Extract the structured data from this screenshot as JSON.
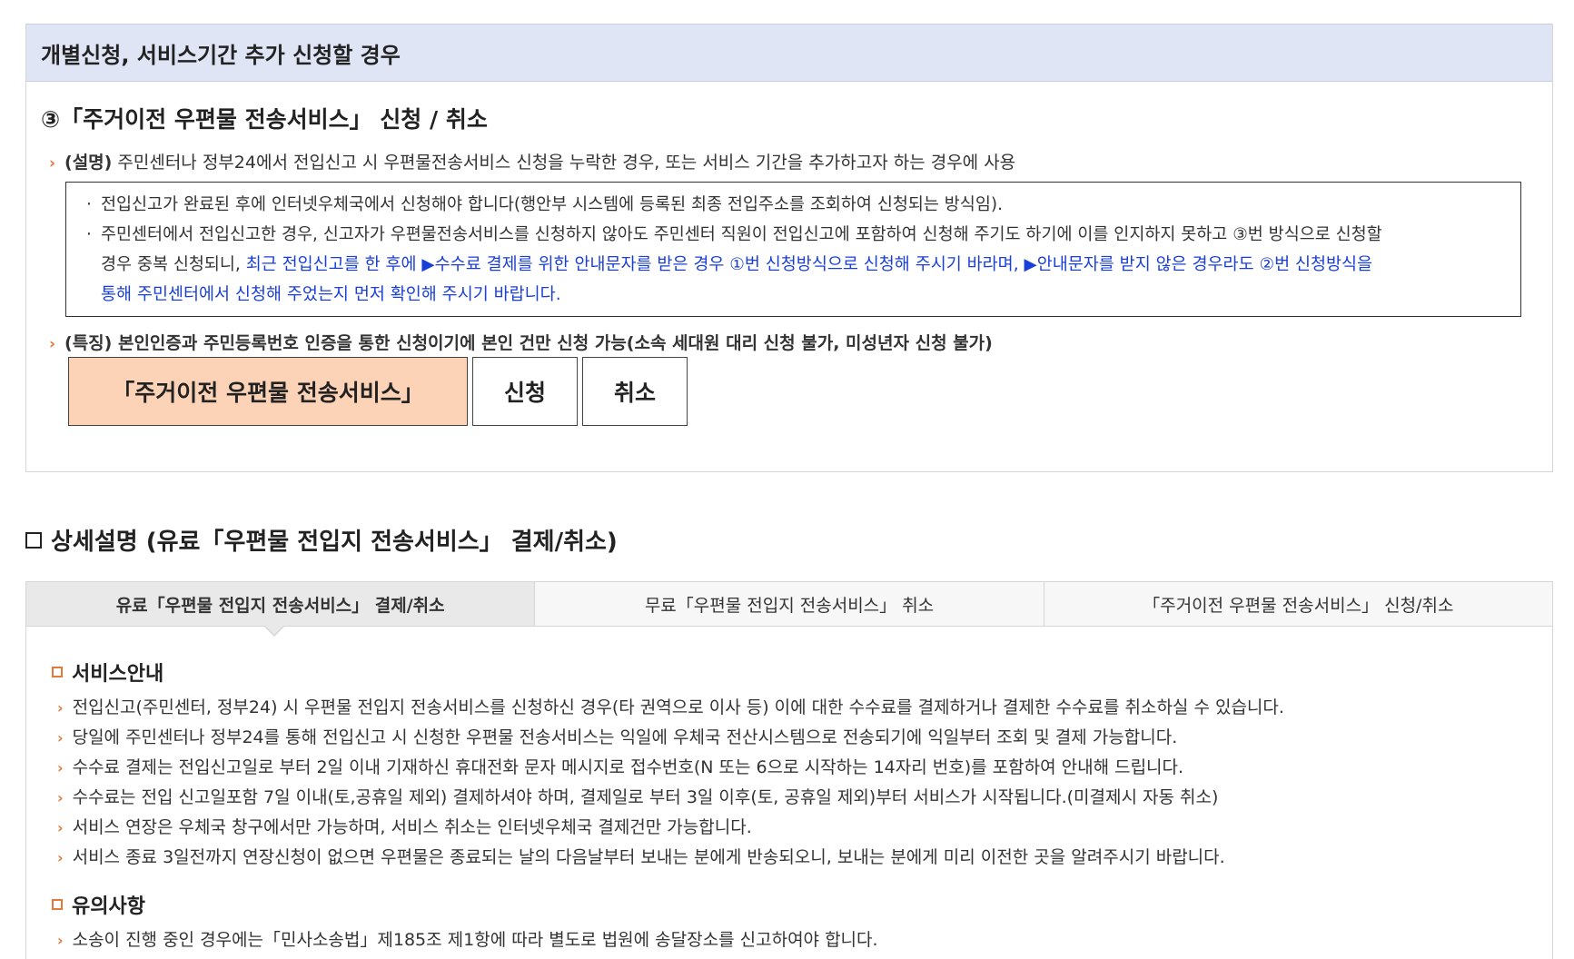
{
  "section": {
    "header": "개별신청, 서비스기간 추가 신청할 경우",
    "title": "③「주거이전 우편물 전송서비스」 신청 / 취소",
    "desc_label": "(설명)",
    "desc_text": "주민센터나 정부24에서 전입신고 시 우편물전송서비스 신청을 누락한 경우, 또는 서비스 기간을 추가하고자 하는 경우에 사용",
    "notes": {
      "n1": "전입신고가 완료된 후에 인터넷우체국에서 신청해야 합니다(행안부 시스템에 등록된 최종 전입주소를 조회하여 신청되는 방식임).",
      "n2_line1": "주민센터에서 전입신고한 경우, 신고자가 우편물전송서비스를 신청하지 않아도 주민센터 직원이 전입신고에 포함하여 신청해 주기도 하기에 이를 인지하지 못하고 ③번 방식으로 신청할",
      "n2_line2_plain": "경우 중복 신청되니,",
      "n2_line2_blue": "최근 전입신고를 한 후에 ▶수수료 결제를 위한 안내문자를 받은 경우 ①번 신청방식으로 신청해 주시기 바라며, ▶안내문자를 받지 않은 경우라도 ②번 신청방식을",
      "n2_line3_blue": "통해 주민센터에서 신청해 주었는지 먼저 확인해 주시기 바랍니다."
    },
    "feature": "(특징) 본인인증과 주민등록번호 인증을 통한 신청이기에 본인 건만 신청 가능(소속 세대원 대리 신청 불가, 미성년자 신청 불가)",
    "buttons": {
      "main": "「주거이전 우편물 전송서비스」",
      "apply": "신청",
      "cancel": "취소"
    }
  },
  "detail": {
    "title": "상세설명 (유료「우편물 전입지 전송서비스」 결제/취소)",
    "tabs": [
      "유료「우편물 전입지 전송서비스」 결제/취소",
      "무료「우편물 전입지 전송서비스」 취소",
      "「주거이전 우편물 전송서비스」 신청/취소"
    ],
    "service_title": "서비스안내",
    "service_items": [
      "전입신고(주민센터, 정부24) 시 우편물 전입지 전송서비스를 신청하신 경우(타 권역으로 이사 등) 이에 대한 수수료를 결제하거나 결제한 수수료를 취소하실 수 있습니다.",
      "당일에 주민센터나 정부24를 통해 전입신고 시 신청한 우편물 전송서비스는 익일에 우체국 전산시스템으로 전송되기에 익일부터 조회 및 결제 가능합니다.",
      "수수료 결제는 전입신고일로 부터 2일 이내 기재하신 휴대전화 문자 메시지로 접수번호(N 또는 6으로 시작하는 14자리 번호)를 포함하여 안내해 드립니다.",
      "수수료는 전입 신고일포함 7일 이내(토,공휴일 제외) 결제하셔야 하며, 결제일로 부터 3일 이후(토, 공휴일 제외)부터 서비스가 시작됩니다.(미결제시 자동 취소)",
      "서비스 연장은 우체국 창구에서만 가능하며, 서비스 취소는 인터넷우체국 결제건만 가능합니다.",
      "서비스 종료 3일전까지 연장신청이 없으면 우편물은 종료되는 날의 다음날부터 보내는 분에게 반송되오니, 보내는 분에게 미리 이전한 곳을 알려주시기 바랍니다."
    ],
    "caution_title": "유의사항",
    "caution_items": [
      "소송이 진행 중인 경우에는「민사소송법」제185조 제1항에 따라 별도로 법원에 송달장소를 신고하여야 합니다."
    ]
  }
}
